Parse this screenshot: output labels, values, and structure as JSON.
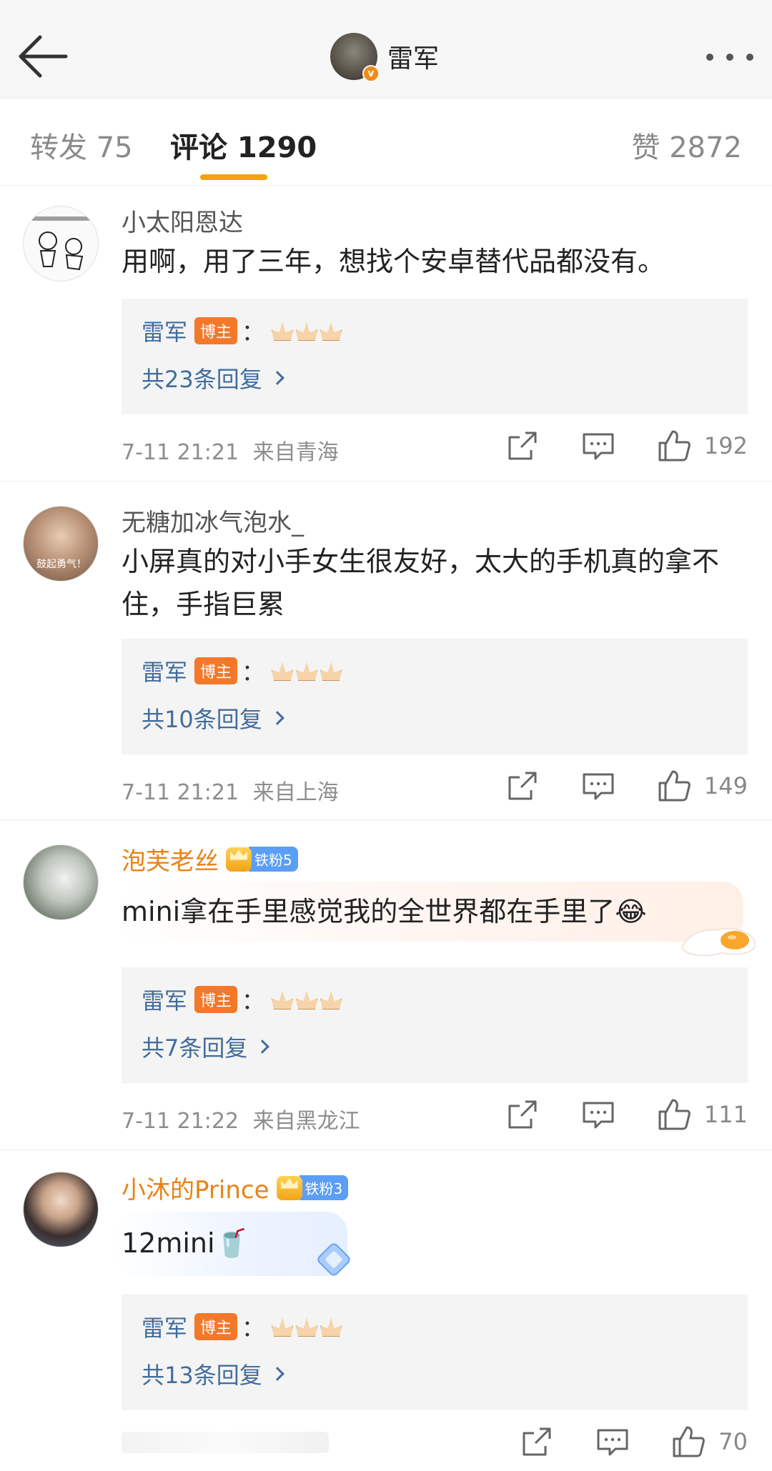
{
  "header": {
    "author_name": "雷军"
  },
  "tabs": {
    "repost": "转发 75",
    "comments": "评论 1290",
    "likes": "赞 2872"
  },
  "comments": [
    {
      "username": "小太阳恩达",
      "text": "用啊，用了三年，想找个安卓替代品都没有。",
      "reply": {
        "author": "雷军",
        "badge": "博主",
        "colon": "：",
        "count_label": "共23条回复"
      },
      "time": "7-11 21:21",
      "location": "来自青海",
      "likes": "192"
    },
    {
      "username": "无糖加冰气泡水_",
      "avatar_text": "鼓起勇气！",
      "text": "小屏真的对小手女生很友好，太大的手机真的拿不住，手指巨累",
      "reply": {
        "author": "雷军",
        "badge": "博主",
        "colon": "：",
        "count_label": "共10条回复"
      },
      "time": "7-11 21:21",
      "location": "来自上海",
      "likes": "149"
    },
    {
      "username": "泡芙老丝",
      "fan_badge": "铁粉5",
      "text": "mini拿在手里感觉我的全世界都在手里了😂",
      "reply": {
        "author": "雷军",
        "badge": "博主",
        "colon": "：",
        "count_label": "共7条回复"
      },
      "time": "7-11 21:22",
      "location": "来自黑龙江",
      "likes": "111"
    },
    {
      "username": "小沐的Prince",
      "fan_badge": "铁粉3",
      "text": "12mini🥤",
      "reply": {
        "author": "雷军",
        "badge": "博主",
        "colon": "：",
        "count_label": "共13条回复"
      },
      "likes": "70"
    }
  ],
  "icons": {
    "back": "back-arrow-icon",
    "more": "more-dots-icon",
    "share": "share-icon",
    "comment": "comment-icon",
    "like": "like-icon"
  },
  "colors": {
    "accent_underline": "#f3a212",
    "reply_link": "#416d9e",
    "host_badge": "#f3782a",
    "fan_badge": "#5b9ef6",
    "username_highlight": "#e8831a"
  }
}
